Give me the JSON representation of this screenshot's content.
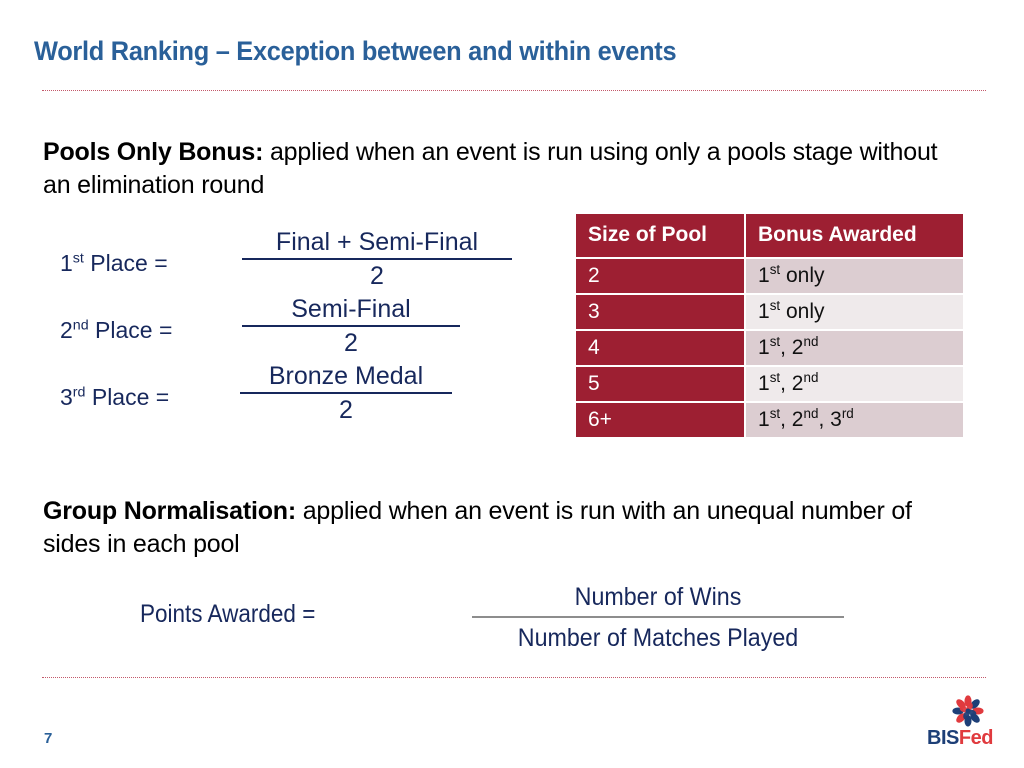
{
  "slide": {
    "title": "World Ranking – Exception between and within events",
    "page_number": "7"
  },
  "pools_only": {
    "heading": "Pools Only Bonus:",
    "description": " applied when an event is run using only a pools stage without an elimination round"
  },
  "place_formulas": [
    {
      "label_number": "1",
      "label_suffix": "st",
      "label_rest": " Place =",
      "numerator": "Final + Semi-Final",
      "denominator": "2"
    },
    {
      "label_number": "2",
      "label_suffix": "nd",
      "label_rest": " Place =",
      "numerator": "Semi-Final",
      "denominator": "2"
    },
    {
      "label_number": "3",
      "label_suffix": "rd",
      "label_rest": " Place =",
      "numerator": "Bronze Medal",
      "denominator": "2"
    }
  ],
  "bonus_table": {
    "headers": [
      "Size of Pool",
      "Bonus Awarded"
    ],
    "rows": [
      {
        "size": "2",
        "bonus_html": "1<sup>st</sup> only"
      },
      {
        "size": "3",
        "bonus_html": "1<sup>st</sup> only"
      },
      {
        "size": "4",
        "bonus_html": "1<sup>st</sup>, 2<sup>nd</sup>"
      },
      {
        "size": "5",
        "bonus_html": "1<sup>st</sup>, 2<sup>nd</sup>"
      },
      {
        "size": "6+",
        "bonus_html": "1<sup>st</sup>, 2<sup>nd</sup>, 3<sup>rd</sup>"
      }
    ]
  },
  "group_normalisation": {
    "heading": "Group Normalisation:",
    "description": " applied when an event is run with an unequal number of sides in each pool",
    "formula_label": "Points Awarded =",
    "numerator": "Number of Wins",
    "denominator": "Number of Matches Played"
  },
  "logo": {
    "part_one": "BIS",
    "part_two": "Fed",
    "blue": "#1d3f77",
    "red": "#e03a3e"
  },
  "colors": {
    "title_blue": "#2a6099",
    "navy": "#17285c",
    "table_crimson": "#9d1f32",
    "row_odd": "#dccdd1",
    "row_even": "#efeaeb",
    "rule_red": "#c3596b"
  }
}
